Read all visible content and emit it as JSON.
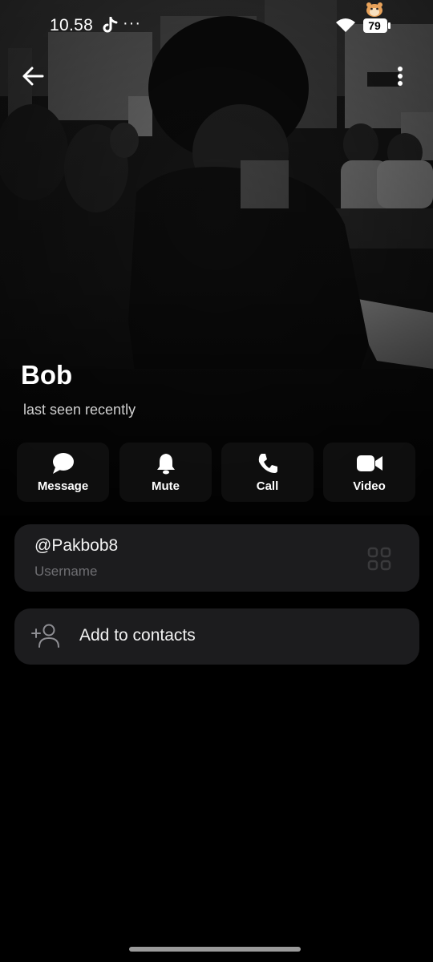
{
  "status_bar": {
    "time": "10.58",
    "more_indicator": "···",
    "battery_level": "79",
    "icons": [
      "tiktok-icon",
      "hamster-icon",
      "wifi-icon",
      "battery-icon"
    ]
  },
  "top_bar": {
    "back_icon": "arrow-left-icon",
    "menu_icon": "more-vertical-icon"
  },
  "profile": {
    "name": "Bob",
    "status": "last seen recently"
  },
  "actions": [
    {
      "label": "Message",
      "icon": "chat-bubble-icon"
    },
    {
      "label": "Mute",
      "icon": "bell-icon"
    },
    {
      "label": "Call",
      "icon": "phone-icon"
    },
    {
      "label": "Video",
      "icon": "video-camera-icon"
    }
  ],
  "username_card": {
    "value": "@Pakbob8",
    "label": "Username",
    "icon": "qr-code-icon"
  },
  "contacts_card": {
    "label": "Add to contacts",
    "icon": "add-user-icon"
  },
  "colors": {
    "background": "#000000",
    "card": "#1c1c1e",
    "text_primary": "#ffffff",
    "text_secondary": "#6f6f73"
  }
}
